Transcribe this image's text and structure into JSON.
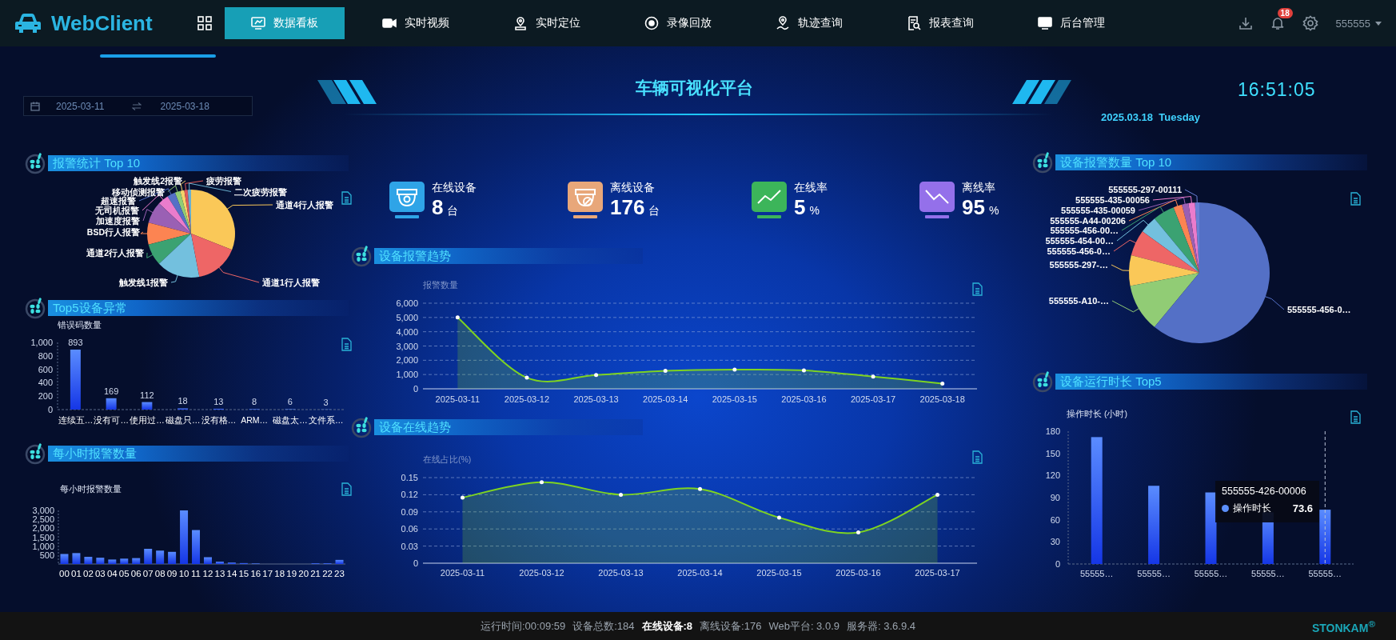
{
  "header": {
    "logo": "WebClient",
    "nav": [
      {
        "label": "数据看板",
        "kind": "board",
        "selected": true
      },
      {
        "label": "实时视频",
        "kind": "video",
        "selected": false
      },
      {
        "label": "实时定位",
        "kind": "pin",
        "selected": false
      },
      {
        "label": "录像回放",
        "kind": "replay",
        "selected": false
      },
      {
        "label": "轨迹查询",
        "kind": "track",
        "selected": false
      },
      {
        "label": "报表查询",
        "kind": "report",
        "selected": false
      },
      {
        "label": "后台管理",
        "kind": "admin",
        "selected": false
      }
    ],
    "notifications": "18",
    "user": "555555"
  },
  "banner": {
    "date_range": {
      "start": "2025-03-11",
      "end": "2025-03-18"
    },
    "title": "车辆可视化平台",
    "clock": "16:51:05",
    "date": "2025.03.18  Tuesday"
  },
  "stats": [
    {
      "label": "在线设备",
      "value": "8",
      "unit": "台",
      "kind": "camera",
      "color": "#2fa4e7"
    },
    {
      "label": "离线设备",
      "value": "176",
      "unit": "台",
      "kind": "camera-off",
      "color": "#e8a77a"
    },
    {
      "label": "在线率",
      "value": "5",
      "unit": "%",
      "kind": "trend-up",
      "color": "#3cb55a"
    },
    {
      "label": "离线率",
      "value": "95",
      "unit": "%",
      "kind": "trend-down",
      "color": "#9470ea"
    }
  ],
  "alarm_stats": {
    "title": "报警统计 Top 10",
    "slices": [
      {
        "label": "触发线2报警",
        "color": "#f5d46a"
      },
      {
        "label": "疲劳报警",
        "color": "#e05a5a"
      },
      {
        "label": "移动侦测报警",
        "color": "#91cc75"
      },
      {
        "label": "二次疲劳报警",
        "color": "#6ab0d0"
      },
      {
        "label": "超速报警",
        "color": "#5470c6"
      },
      {
        "label": "通道4行人报警",
        "color": "#fac858"
      },
      {
        "label": "无司机报警",
        "color": "#ea7ccc"
      },
      {
        "label": "加速度报警",
        "color": "#9a60b4"
      },
      {
        "label": "BSD行人报警",
        "color": "#fc8452"
      },
      {
        "label": "通道2行人报警",
        "color": "#3ba272"
      },
      {
        "label": "触发线1报警",
        "color": "#73c0de"
      },
      {
        "label": "通道1行人报警",
        "color": "#ee6666"
      }
    ]
  },
  "device_errors": {
    "title": "Top5设备异常",
    "chart_data": {
      "type": "bar",
      "ylabel": "错误码数量",
      "categories": [
        "连续五…",
        "没有可…",
        "使用过…",
        "磁盘只…",
        "没有格…",
        "ARM…",
        "磁盘太…",
        "文件系…"
      ],
      "values": [
        893,
        169,
        112,
        18,
        13,
        8,
        6,
        3
      ],
      "ylim": [
        0,
        1000
      ],
      "yticks": [
        0,
        200,
        400,
        600,
        800,
        {
          "value": 1000,
          "label": "1,000"
        }
      ],
      "data_labels": true
    }
  },
  "hourly_alarms": {
    "title": "每小时报警数量",
    "chart_data": {
      "type": "bar",
      "ylabel": "每小时报警数量",
      "categories": [
        "00",
        "01",
        "02",
        "03",
        "04",
        "05",
        "06",
        "07",
        "08",
        "09",
        "10",
        "11",
        "12",
        "13",
        "14",
        "15",
        "16",
        "17",
        "18",
        "19",
        "20",
        "21",
        "22",
        "23"
      ],
      "values": [
        560,
        610,
        400,
        350,
        250,
        300,
        330,
        850,
        750,
        680,
        3000,
        1900,
        380,
        130,
        80,
        50,
        30,
        null,
        null,
        null,
        null,
        40,
        40,
        230
      ],
      "ylim": [
        0,
        3000
      ],
      "yticks": [
        500,
        {
          "value": 1000,
          "label": "1,000"
        },
        {
          "value": 1500,
          "label": "1,500"
        },
        {
          "value": 2000,
          "label": "2,000"
        },
        {
          "value": 2500,
          "label": "2,500"
        },
        {
          "value": 3000,
          "label": "3,000"
        }
      ]
    }
  },
  "alarm_trend": {
    "title": "设备报警趋势",
    "chart_data": {
      "type": "area",
      "ylabel": "报警数量",
      "grid": true,
      "categories": [
        "2025-03-11",
        "2025-03-12",
        "2025-03-13",
        "2025-03-14",
        "2025-03-15",
        "2025-03-16",
        "2025-03-17",
        "2025-03-18"
      ],
      "series": [
        {
          "color": "#7ed321",
          "values": [
            5000,
            780,
            970,
            1260,
            1340,
            1290,
            860,
            370
          ]
        }
      ],
      "ylim": [
        0,
        6000
      ],
      "yticks": [
        0,
        {
          "value": 1000,
          "label": "1,000"
        },
        {
          "value": 2000,
          "label": "2,000"
        },
        {
          "value": 3000,
          "label": "3,000"
        },
        {
          "value": 4000,
          "label": "4,000"
        },
        {
          "value": 5000,
          "label": "5,000"
        },
        {
          "value": 6000,
          "label": "6,000"
        }
      ]
    }
  },
  "online_trend": {
    "title": "设备在线趋势",
    "chart_data": {
      "type": "area",
      "ylabel": "在线占比(%)",
      "grid": true,
      "categories": [
        "2025-03-11",
        "2025-03-12",
        "2025-03-13",
        "2025-03-14",
        "2025-03-15",
        "2025-03-16",
        "2025-03-17"
      ],
      "series": [
        {
          "color": "#7ed321",
          "values": [
            0.115,
            0.142,
            0.12,
            0.13,
            0.08,
            0.054,
            0.12
          ]
        }
      ],
      "ylim": [
        0,
        0.15
      ],
      "yticks": [
        0,
        0.03,
        0.06,
        0.09,
        0.12,
        0.15
      ]
    }
  },
  "device_alarm_top": {
    "title": "设备报警数量 Top 10",
    "slices": [
      {
        "label": "555555-297-00111",
        "color": "#6a80d6"
      },
      {
        "label": "555555-435-00056",
        "color": "#ea7ccc"
      },
      {
        "label": "555555-435-00059",
        "color": "#9a60b4"
      },
      {
        "label": "555555-A44-00206",
        "color": "#fc8452"
      },
      {
        "label": "555555-456-00…",
        "color": "#3ba272"
      },
      {
        "label": "555555-454-00…",
        "color": "#73c0de"
      },
      {
        "label": "555555-456-0…",
        "color": "#ee6666"
      },
      {
        "label": "555555-297-…",
        "color": "#fac858"
      },
      {
        "label": "555555-A10-…",
        "color": "#91cc75"
      },
      {
        "label": "555555-456-0…",
        "color": "#5470c6"
      }
    ]
  },
  "runtime_top": {
    "title": "设备运行时长 Top5",
    "chart_data": {
      "type": "bar",
      "ylabel": "操作时长 (小时)",
      "categories": [
        "55555…",
        "55555…",
        "55555…",
        "55555…",
        "55555…"
      ],
      "values": [
        172,
        106,
        97,
        70,
        73.6
      ],
      "ylim": [
        0,
        180
      ],
      "yticks": [
        0,
        30,
        60,
        90,
        120,
        150,
        180
      ]
    },
    "tooltip": {
      "title": "555555-426-00006",
      "series": "操作时长",
      "value": "73.6"
    }
  },
  "status_bar": {
    "items": [
      {
        "text": "运行时间:00:09:59",
        "highlighted": false
      },
      {
        "text": "设备总数:184",
        "highlighted": false
      },
      {
        "text": "在线设备:8",
        "highlighted": true
      },
      {
        "text": "离线设备:176",
        "highlighted": false
      },
      {
        "text": "Web平台: 3.0.9",
        "highlighted": false
      },
      {
        "text": "服务器: 3.6.9.4",
        "highlighted": false
      }
    ],
    "brand": "STONKAM$^{®}$"
  }
}
